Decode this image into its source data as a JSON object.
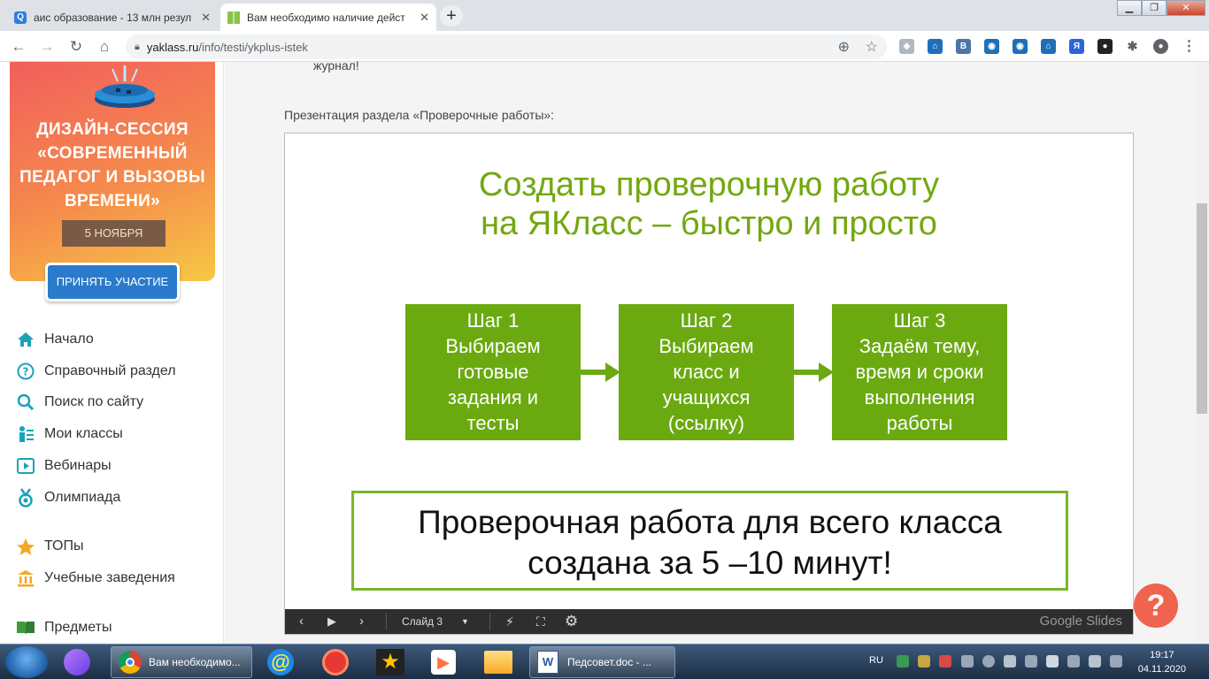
{
  "browser": {
    "tabs": [
      {
        "title": "аис образование - 13 млн резул",
        "active": false
      },
      {
        "title": "Вам необходимо наличие дейст",
        "active": true
      }
    ],
    "url_host": "yaklass.ru",
    "url_path": "/info/testi/ykplus-istek"
  },
  "sidebar": {
    "banner": {
      "title": "ДИЗАЙН-СЕССИЯ «СОВРЕМЕННЫЙ ПЕДАГОГ И ВЫЗОВЫ ВРЕМЕНИ»",
      "date": "5 НОЯБРЯ",
      "button": "ПРИНЯТЬ УЧАСТИЕ"
    },
    "items": [
      {
        "label": "Начало",
        "icon": "home-icon"
      },
      {
        "label": "Справочный раздел",
        "icon": "question-icon"
      },
      {
        "label": "Поиск по сайту",
        "icon": "search-icon"
      },
      {
        "label": "Мои классы",
        "icon": "classes-icon"
      },
      {
        "label": "Вебинары",
        "icon": "video-icon"
      },
      {
        "label": "Олимпиада",
        "icon": "medal-icon"
      },
      {
        "label": "ТОПы",
        "icon": "star-icon"
      },
      {
        "label": "Учебные заведения",
        "icon": "building-icon"
      },
      {
        "label": "Предметы",
        "icon": "book-icon"
      }
    ]
  },
  "main": {
    "journal_text": "журнал!",
    "caption": "Презентация раздела «Проверочные работы»:",
    "slide": {
      "title_line1": "Создать проверочную работу",
      "title_line2": "на ЯКласс – быстро и просто",
      "steps": [
        {
          "heading": "Шаг 1",
          "text": "Выбираем готовые задания и тесты"
        },
        {
          "heading": "Шаг 2",
          "text": "Выбираем класс и учащихся (ссылку)"
        },
        {
          "heading": "Шаг 3",
          "text": "Задаём тему, время и сроки выполнения работы"
        }
      ],
      "summary_line1": "Проверочная работа для всего класса",
      "summary_line2": "создана за 5 –10 минут!",
      "controls": {
        "slide_label": "Слайд 3",
        "brand": "Google Slides"
      }
    },
    "help": "?"
  },
  "taskbar": {
    "tasks": [
      {
        "label": "Вам необходимо..."
      },
      {
        "label": "Педсовет.doc - ..."
      }
    ],
    "lang": "RU",
    "time": "19:17",
    "date": "04.11.2020"
  },
  "colors": {
    "slide_green": "#6aaa10",
    "title_green": "#72a80f",
    "banner_orange": "#f58a4c",
    "menu_teal": "#1aa3b8",
    "help_red": "#f0634f"
  }
}
